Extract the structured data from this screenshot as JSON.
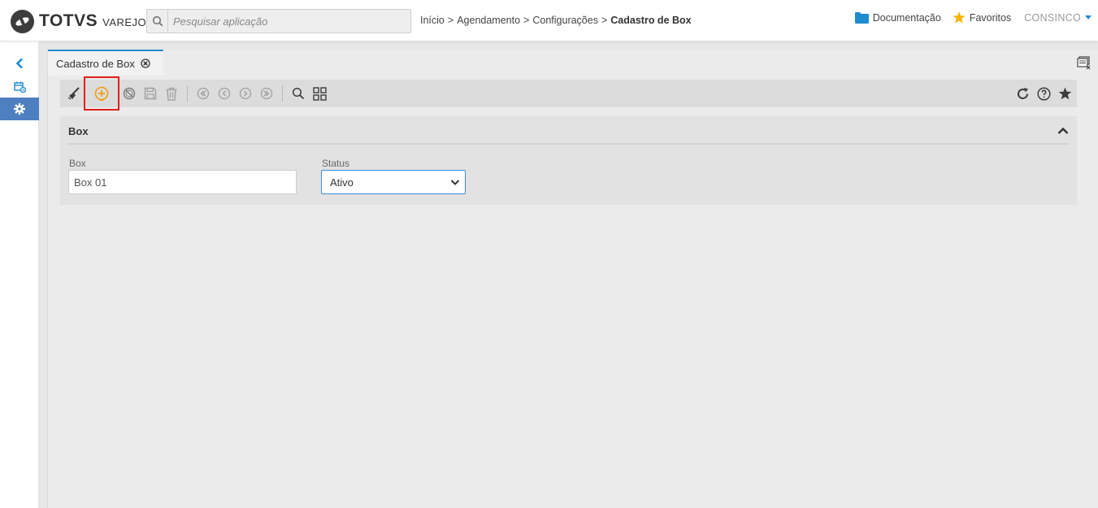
{
  "header": {
    "brand": "TOTVS",
    "brand_sub": "VAREJO",
    "search_placeholder": "Pesquisar aplicação",
    "breadcrumb": [
      "Início",
      "Agendamento",
      "Configurações",
      "Cadastro de Box"
    ],
    "breadcrumb_sep": ">",
    "docs_label": "Documentação",
    "favorites_label": "Favoritos",
    "user_label": "CONSINCO"
  },
  "sidebar": {
    "items": [
      {
        "icon": "chevron-left-icon"
      },
      {
        "icon": "calendar-gear-icon"
      },
      {
        "icon": "gear-icon",
        "active": true
      }
    ]
  },
  "tab": {
    "label": "Cadastro de Box"
  },
  "toolbar": {
    "left": [
      "clean-icon",
      "add-icon",
      "cancel-icon",
      "save-icon",
      "delete-icon",
      "first-icon",
      "previous-icon",
      "next-icon",
      "last-icon",
      "search-icon",
      "grid-icon"
    ],
    "right": [
      "refresh-icon",
      "help-icon",
      "favorite-star-icon"
    ],
    "highlighted": "add-icon"
  },
  "panel": {
    "title": "Box",
    "fields": {
      "box_label": "Box",
      "box_value": "Box 01",
      "status_label": "Status",
      "status_value": "Ativo"
    }
  },
  "colors": {
    "accent": "#1d8ccf",
    "sidebar_active": "#4e80c1",
    "add_icon": "#f39c12",
    "highlight_border": "#e0201c",
    "star": "#f5b400"
  }
}
